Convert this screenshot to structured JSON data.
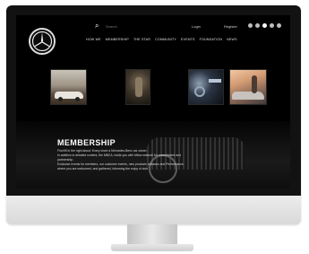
{
  "site": {
    "search": {
      "placeholder": "Search"
    },
    "auth": {
      "login": "Login",
      "register": "Register"
    },
    "nav": [
      "HOW WE",
      "MEMBERSHIP",
      "THE STAR",
      "COMMUNITY",
      "EVENTS",
      "FOUNDATION",
      "NEWS"
    ],
    "social_icons": [
      "instagram-icon",
      "facebook-icon",
      "youtube-icon",
      "twitter-icon",
      "linkedin-icon"
    ],
    "thumbnails": [
      {
        "name": "classic-cars-photo"
      },
      {
        "name": "garage-scene-photo"
      },
      {
        "name": "car-interior-photo"
      },
      {
        "name": "sunset-convertible-photo"
      }
    ],
    "membership": {
      "title": "MEMBERSHIP",
      "paragraphs": [
        "Find fill in the right about: Every since a Mercedes-Benz car owner.",
        "In addition to detailed content, the MBCA, holds you with Mbca network for commitment and partnership.",
        "Exclusive events for members, our customer events, new products releases and Performance, where you are welcomed, and gathered, informing the enjoy of club."
      ]
    }
  },
  "colors": {
    "screen_bg": "#000000",
    "bezel": "#121212",
    "chin": "#e4e4e4",
    "text": "#ffffff"
  }
}
